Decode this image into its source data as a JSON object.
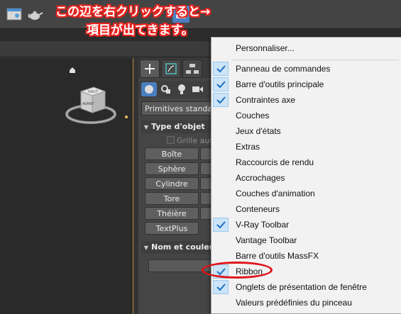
{
  "annotation": {
    "line1": "この辺を右クリックすると→",
    "line2": "項目が出てきます。",
    "color": "#e8231e"
  },
  "toolbar": {
    "icons": [
      "window-icon",
      "teapot-icon",
      "render-setup-icon",
      "render-frame-icon",
      "render-icon"
    ]
  },
  "viewport": {
    "viewcube": {
      "top_label": "HAUT",
      "front_label": "AVANT"
    }
  },
  "command_panel": {
    "tabs": [
      "create-tab",
      "modify-tab",
      "hierarchy-tab"
    ],
    "dropdown_value": "Primitives standard",
    "object_type": {
      "title": "Type d'objet",
      "autogrid_label": "Grille autom",
      "buttons": [
        "Boîte",
        "Sphère",
        "Cylindre",
        "Tore",
        "Théière",
        "TextPlus"
      ]
    },
    "name_color": {
      "title": "Nom et couleur"
    }
  },
  "context_menu": {
    "items": [
      {
        "label": "Personnaliser...",
        "checked": false
      },
      {
        "label": "Panneau de commandes",
        "checked": true
      },
      {
        "label": "Barre d'outils principale",
        "checked": true
      },
      {
        "label": "Contraintes axe",
        "checked": true
      },
      {
        "label": "Couches",
        "checked": false
      },
      {
        "label": "Jeux d'états",
        "checked": false
      },
      {
        "label": "Extras",
        "checked": false
      },
      {
        "label": "Raccourcis de rendu",
        "checked": false
      },
      {
        "label": "Accrochages",
        "checked": false
      },
      {
        "label": "Couches d'animation",
        "checked": false
      },
      {
        "label": "Conteneurs",
        "checked": false
      },
      {
        "label": "V-Ray Toolbar",
        "checked": true
      },
      {
        "label": "Vantage Toolbar",
        "checked": false
      },
      {
        "label": "Barre d'outils MassFX",
        "checked": false
      },
      {
        "label": "Ribbon",
        "checked": true
      },
      {
        "label": "Onglets de présentation de fenêtre",
        "checked": true
      },
      {
        "label": "Valeurs prédéfinies du pinceau",
        "checked": false
      }
    ],
    "check_color": "#1d6fc4",
    "highlight_item": "Ribbon"
  }
}
